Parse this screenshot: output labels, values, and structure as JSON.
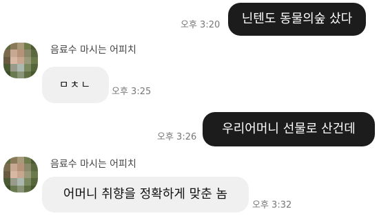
{
  "messages": [
    {
      "text": "닌텐도 동물의숲 샀다",
      "time": "오후 3:20"
    },
    {
      "sender": "음료수 마시는 어피치",
      "text": "ㅁㅊㄴ",
      "time": "오후 3:25"
    },
    {
      "text": "우리어머니 선물로 산건데",
      "time": "오후 3:26"
    },
    {
      "sender": "음료수 마시는 어피치",
      "text": "어머니 취향을 정확하게 맞춘 놈",
      "time": "오후 3:32"
    }
  ],
  "colors": {
    "sent_bubble": "#1c1c1c",
    "received_bubble": "#f0f0f0"
  }
}
